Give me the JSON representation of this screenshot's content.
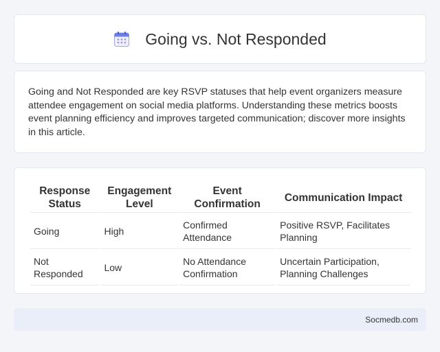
{
  "header": {
    "title": "Going vs. Not Responded",
    "icon": "calendar-icon"
  },
  "intro": {
    "text": "Going and Not Responded are key RSVP statuses that help event organizers measure attendee engagement on social media platforms. Understanding these metrics boosts event planning efficiency and improves targeted communication; discover more insights in this article."
  },
  "table": {
    "headers": [
      "Response Status",
      "Engagement Level",
      "Event Confirmation",
      "Communication Impact"
    ],
    "rows": [
      [
        "Going",
        "High",
        "Confirmed Attendance",
        "Positive RSVP, Facilitates Planning"
      ],
      [
        "Not Responded",
        "Low",
        "No Attendance Confirmation",
        "Uncertain Participation, Planning Challenges"
      ]
    ]
  },
  "footer": {
    "site": "Socmedb.com"
  }
}
